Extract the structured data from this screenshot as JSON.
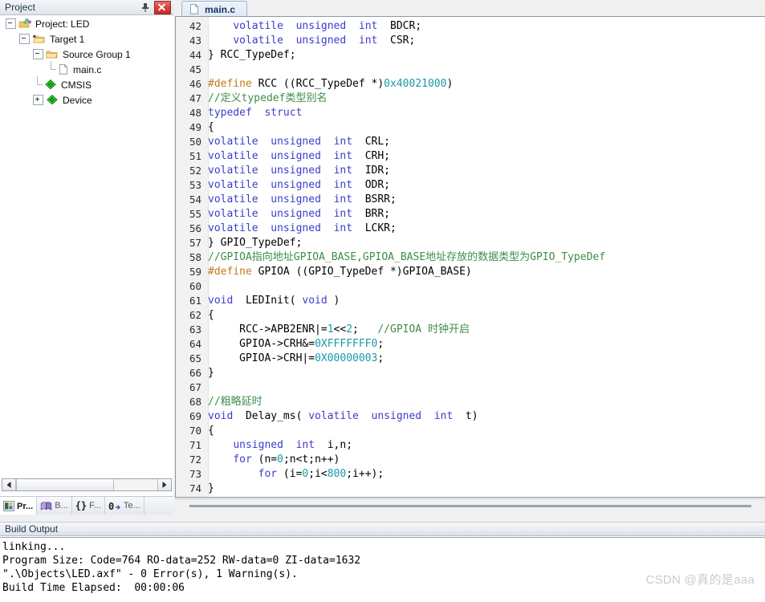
{
  "project_panel": {
    "title": "Project",
    "pin_tooltip": "Auto Hide",
    "close_tooltip": "Close",
    "tree": [
      {
        "label": "Project: LED",
        "level": 1,
        "icon": "project-icon",
        "expander": "minus"
      },
      {
        "label": "Target 1",
        "level": 2,
        "icon": "target-folder-icon",
        "expander": "minus"
      },
      {
        "label": "Source Group 1",
        "level": 3,
        "icon": "folder-icon",
        "expander": "minus"
      },
      {
        "label": "main.c",
        "level": 4,
        "icon": "c-file-icon",
        "expander": "none"
      },
      {
        "label": "CMSIS",
        "level": 3,
        "icon": "green-diamond-icon",
        "expander": "none"
      },
      {
        "label": "Device",
        "level": 3,
        "icon": "green-diamond-icon",
        "expander": "plus"
      }
    ],
    "tabs": [
      {
        "label": "Pr...",
        "icon": "project-window-icon",
        "active": true
      },
      {
        "label": "B...",
        "icon": "books-icon",
        "active": false
      },
      {
        "label": "F...",
        "icon": "braces-icon",
        "active": false
      },
      {
        "label": "Te...",
        "icon": "templates-icon",
        "active": false
      }
    ]
  },
  "editor": {
    "tab": {
      "label": "main.c",
      "icon": "c-file-icon"
    },
    "first_line_number": 42,
    "lines": [
      {
        "n": 42,
        "tokens": [
          {
            "t": "    ",
            "c": "tx"
          },
          {
            "t": "volatile",
            "c": "k"
          },
          {
            "t": "  ",
            "c": "tx"
          },
          {
            "t": "unsigned",
            "c": "k"
          },
          {
            "t": "  ",
            "c": "tx"
          },
          {
            "t": "int",
            "c": "k"
          },
          {
            "t": "  BDCR;",
            "c": "tx"
          }
        ]
      },
      {
        "n": 43,
        "tokens": [
          {
            "t": "    ",
            "c": "tx"
          },
          {
            "t": "volatile",
            "c": "k"
          },
          {
            "t": "  ",
            "c": "tx"
          },
          {
            "t": "unsigned",
            "c": "k"
          },
          {
            "t": "  ",
            "c": "tx"
          },
          {
            "t": "int",
            "c": "k"
          },
          {
            "t": "  CSR;",
            "c": "tx"
          }
        ]
      },
      {
        "n": 44,
        "tokens": [
          {
            "t": "} RCC_TypeDef;",
            "c": "tx"
          }
        ]
      },
      {
        "n": 45,
        "tokens": []
      },
      {
        "n": 46,
        "tokens": [
          {
            "t": "#define",
            "c": "pp"
          },
          {
            "t": " RCC ((RCC_TypeDef *)",
            "c": "tx"
          },
          {
            "t": "0x40021000",
            "c": "nm"
          },
          {
            "t": ")",
            "c": "tx"
          }
        ]
      },
      {
        "n": 47,
        "tokens": [
          {
            "t": "//定义typedef类型别名",
            "c": "cm"
          }
        ]
      },
      {
        "n": 48,
        "tokens": [
          {
            "t": "typedef",
            "c": "k"
          },
          {
            "t": "  ",
            "c": "tx"
          },
          {
            "t": "struct",
            "c": "k"
          }
        ]
      },
      {
        "n": 49,
        "tokens": [
          {
            "t": "{",
            "c": "tx"
          }
        ]
      },
      {
        "n": 50,
        "tokens": [
          {
            "t": "volatile",
            "c": "k"
          },
          {
            "t": "  ",
            "c": "tx"
          },
          {
            "t": "unsigned",
            "c": "k"
          },
          {
            "t": "  ",
            "c": "tx"
          },
          {
            "t": "int",
            "c": "k"
          },
          {
            "t": "  CRL;",
            "c": "tx"
          }
        ]
      },
      {
        "n": 51,
        "tokens": [
          {
            "t": "volatile",
            "c": "k"
          },
          {
            "t": "  ",
            "c": "tx"
          },
          {
            "t": "unsigned",
            "c": "k"
          },
          {
            "t": "  ",
            "c": "tx"
          },
          {
            "t": "int",
            "c": "k"
          },
          {
            "t": "  CRH;",
            "c": "tx"
          }
        ]
      },
      {
        "n": 52,
        "tokens": [
          {
            "t": "volatile",
            "c": "k"
          },
          {
            "t": "  ",
            "c": "tx"
          },
          {
            "t": "unsigned",
            "c": "k"
          },
          {
            "t": "  ",
            "c": "tx"
          },
          {
            "t": "int",
            "c": "k"
          },
          {
            "t": "  IDR;",
            "c": "tx"
          }
        ]
      },
      {
        "n": 53,
        "tokens": [
          {
            "t": "volatile",
            "c": "k"
          },
          {
            "t": "  ",
            "c": "tx"
          },
          {
            "t": "unsigned",
            "c": "k"
          },
          {
            "t": "  ",
            "c": "tx"
          },
          {
            "t": "int",
            "c": "k"
          },
          {
            "t": "  ODR;",
            "c": "tx"
          }
        ]
      },
      {
        "n": 54,
        "tokens": [
          {
            "t": "volatile",
            "c": "k"
          },
          {
            "t": "  ",
            "c": "tx"
          },
          {
            "t": "unsigned",
            "c": "k"
          },
          {
            "t": "  ",
            "c": "tx"
          },
          {
            "t": "int",
            "c": "k"
          },
          {
            "t": "  BSRR;",
            "c": "tx"
          }
        ]
      },
      {
        "n": 55,
        "tokens": [
          {
            "t": "volatile",
            "c": "k"
          },
          {
            "t": "  ",
            "c": "tx"
          },
          {
            "t": "unsigned",
            "c": "k"
          },
          {
            "t": "  ",
            "c": "tx"
          },
          {
            "t": "int",
            "c": "k"
          },
          {
            "t": "  BRR;",
            "c": "tx"
          }
        ]
      },
      {
        "n": 56,
        "tokens": [
          {
            "t": "volatile",
            "c": "k"
          },
          {
            "t": "  ",
            "c": "tx"
          },
          {
            "t": "unsigned",
            "c": "k"
          },
          {
            "t": "  ",
            "c": "tx"
          },
          {
            "t": "int",
            "c": "k"
          },
          {
            "t": "  LCKR;",
            "c": "tx"
          }
        ]
      },
      {
        "n": 57,
        "tokens": [
          {
            "t": "} GPIO_TypeDef;",
            "c": "tx"
          }
        ]
      },
      {
        "n": 58,
        "tokens": [
          {
            "t": "//GPIOA指向地址GPIOA_BASE,GPIOA_BASE地址存放的数据类型为GPIO_TypeDef",
            "c": "cm"
          }
        ]
      },
      {
        "n": 59,
        "tokens": [
          {
            "t": "#define",
            "c": "pp"
          },
          {
            "t": " GPIOA ((GPIO_TypeDef *)GPIOA_BASE)",
            "c": "tx"
          }
        ]
      },
      {
        "n": 60,
        "tokens": []
      },
      {
        "n": 61,
        "tokens": [
          {
            "t": "void",
            "c": "k"
          },
          {
            "t": "  LEDInit( ",
            "c": "tx"
          },
          {
            "t": "void",
            "c": "k"
          },
          {
            "t": " )",
            "c": "tx"
          }
        ]
      },
      {
        "n": 62,
        "tokens": [
          {
            "t": "{",
            "c": "tx"
          }
        ]
      },
      {
        "n": 63,
        "tokens": [
          {
            "t": "     RCC->APB2ENR|=",
            "c": "tx"
          },
          {
            "t": "1",
            "c": "nm"
          },
          {
            "t": "<<",
            "c": "tx"
          },
          {
            "t": "2",
            "c": "nm"
          },
          {
            "t": ";   ",
            "c": "tx"
          },
          {
            "t": "//GPIOA 时钟开启",
            "c": "cm"
          }
        ]
      },
      {
        "n": 64,
        "tokens": [
          {
            "t": "     GPIOA->CRH&=",
            "c": "tx"
          },
          {
            "t": "0XFFFFFFF0",
            "c": "nm"
          },
          {
            "t": ";",
            "c": "tx"
          }
        ]
      },
      {
        "n": 65,
        "tokens": [
          {
            "t": "     GPIOA->CRH|=",
            "c": "tx"
          },
          {
            "t": "0X00000003",
            "c": "nm"
          },
          {
            "t": ";",
            "c": "tx"
          }
        ]
      },
      {
        "n": 66,
        "tokens": [
          {
            "t": "}",
            "c": "tx"
          }
        ]
      },
      {
        "n": 67,
        "tokens": []
      },
      {
        "n": 68,
        "tokens": [
          {
            "t": "//粗略延时",
            "c": "cm"
          }
        ]
      },
      {
        "n": 69,
        "tokens": [
          {
            "t": "void",
            "c": "k"
          },
          {
            "t": "  Delay_ms( ",
            "c": "tx"
          },
          {
            "t": "volatile",
            "c": "k"
          },
          {
            "t": "  ",
            "c": "tx"
          },
          {
            "t": "unsigned",
            "c": "k"
          },
          {
            "t": "  ",
            "c": "tx"
          },
          {
            "t": "int",
            "c": "k"
          },
          {
            "t": "  t)",
            "c": "tx"
          }
        ]
      },
      {
        "n": 70,
        "tokens": [
          {
            "t": "{",
            "c": "tx"
          }
        ]
      },
      {
        "n": 71,
        "tokens": [
          {
            "t": "    ",
            "c": "tx"
          },
          {
            "t": "unsigned",
            "c": "k"
          },
          {
            "t": "  ",
            "c": "tx"
          },
          {
            "t": "int",
            "c": "k"
          },
          {
            "t": "  i,n;",
            "c": "tx"
          }
        ]
      },
      {
        "n": 72,
        "tokens": [
          {
            "t": "    ",
            "c": "tx"
          },
          {
            "t": "for",
            "c": "k"
          },
          {
            "t": " (n=",
            "c": "tx"
          },
          {
            "t": "0",
            "c": "nm"
          },
          {
            "t": ";n<t;n++)",
            "c": "tx"
          }
        ]
      },
      {
        "n": 73,
        "tokens": [
          {
            "t": "        ",
            "c": "tx"
          },
          {
            "t": "for",
            "c": "k"
          },
          {
            "t": " (i=",
            "c": "tx"
          },
          {
            "t": "0",
            "c": "nm"
          },
          {
            "t": ";i<",
            "c": "tx"
          },
          {
            "t": "800",
            "c": "nm"
          },
          {
            "t": ";i++);",
            "c": "tx"
          }
        ]
      },
      {
        "n": 74,
        "tokens": [
          {
            "t": "}",
            "c": "tx"
          }
        ]
      }
    ]
  },
  "build_output": {
    "title": "Build Output",
    "lines": [
      "linking...",
      "Program Size: Code=764 RO-data=252 RW-data=0 ZI-data=1632",
      "\".\\Objects\\LED.axf\" - 0 Error(s), 1 Warning(s).",
      "Build Time Elapsed:  00:00:06"
    ]
  },
  "watermark": "CSDN @真的是aaa",
  "colors": {
    "keyword": "#3c3ccc",
    "preprocessor": "#c4791a",
    "comment": "#3f8c4a",
    "number": "#1a9aa8",
    "gutter_bg": "#f2f2f2",
    "close_button": "#d9413d",
    "tree_green": "#2ecc2e"
  }
}
